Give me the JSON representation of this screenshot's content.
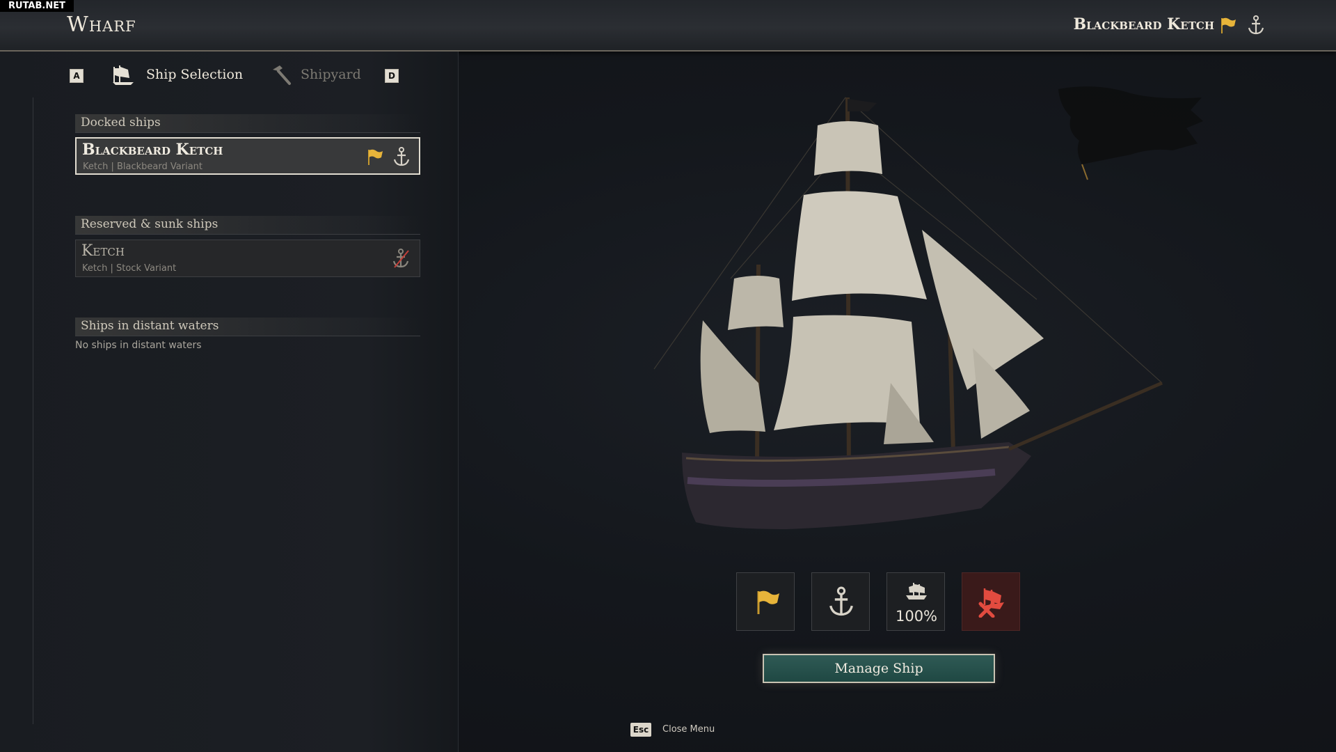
{
  "watermark": "RUTAB.NET",
  "header": {
    "title": "Wharf",
    "active_ship_name": "Blackbeard Ketch"
  },
  "tabs": {
    "prev_key": "A",
    "next_key": "D",
    "items": [
      {
        "label": "Ship Selection",
        "icon": "ship-icon",
        "active": true
      },
      {
        "label": "Shipyard",
        "icon": "hammer-icon",
        "active": false
      }
    ]
  },
  "sections": {
    "docked": {
      "header": "Docked ships",
      "ships": [
        {
          "name": "Blackbeard Ketch",
          "subtitle": "Ketch | Blackbeard Variant",
          "icons": [
            "flag-icon",
            "anchor-icon"
          ],
          "selected": true
        }
      ]
    },
    "reserved": {
      "header": "Reserved & sunk ships",
      "ships": [
        {
          "name": "Ketch",
          "subtitle": "Ketch | Stock Variant",
          "icons": [
            "anchor-disabled-icon"
          ],
          "selected": false
        }
      ]
    },
    "distant": {
      "header": "Ships in distant waters",
      "empty_text": "No ships in distant waters"
    }
  },
  "ship_actions": {
    "repair_value": "100%",
    "manage_label": "Manage Ship"
  },
  "footer": {
    "key": "Esc",
    "label": "Close Menu"
  },
  "colors": {
    "flag": "#e7b43a",
    "accent_teal": "#2a5550",
    "danger": "#e24b3f"
  }
}
